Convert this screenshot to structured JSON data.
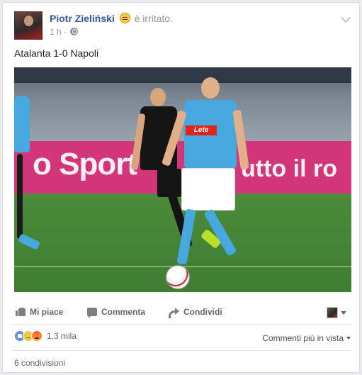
{
  "post": {
    "author": "Piotr Zieliński",
    "feeling": "è irritato.",
    "time": "1 h",
    "separator": "·",
    "text": "Atalanta 1-0 Napoli"
  },
  "photo": {
    "board_left": "o Sport",
    "board_right": "utto il ro",
    "shirt_sponsor": "Lete"
  },
  "actions": {
    "like": "Mi piace",
    "comment": "Commenta",
    "share": "Condividi"
  },
  "reactions": {
    "count": "1,3 mila",
    "sort": "Commenti più in vista"
  },
  "shares": "6 condivisioni",
  "colors": {
    "link": "#365899",
    "meta": "#90949c",
    "action": "#606770",
    "board": "#d23679",
    "napoli_blue": "#47a8e0"
  }
}
